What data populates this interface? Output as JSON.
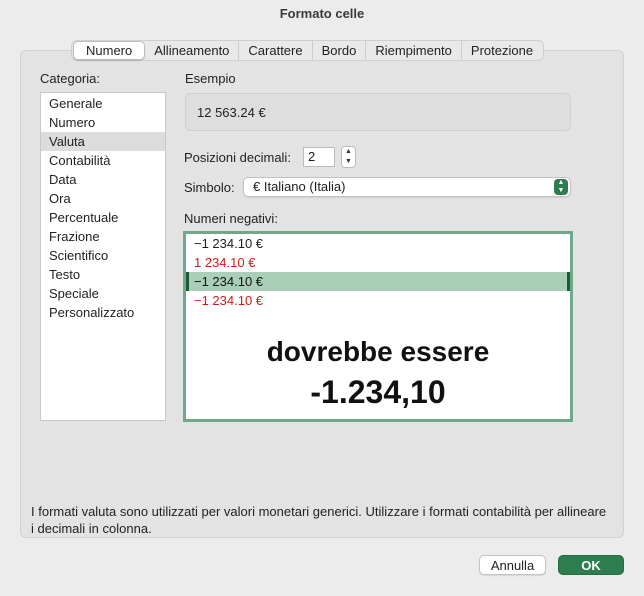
{
  "window": {
    "title": "Formato celle"
  },
  "tabs": [
    "Numero",
    "Allineamento",
    "Carattere",
    "Bordo",
    "Riempimento",
    "Protezione"
  ],
  "active_tab": "Numero",
  "category": {
    "label": "Categoria:",
    "items": [
      "Generale",
      "Numero",
      "Valuta",
      "Contabilità",
      "Data",
      "Ora",
      "Percentuale",
      "Frazione",
      "Scientifico",
      "Testo",
      "Speciale",
      "Personalizzato"
    ],
    "selected": "Valuta"
  },
  "example": {
    "label": "Esempio",
    "value": "12 563.24 €"
  },
  "decimals": {
    "label": "Posizioni decimali:",
    "value": "2"
  },
  "symbol": {
    "label": "Simbolo:",
    "value": "€ Italiano (Italia)"
  },
  "negatives": {
    "label": "Numeri negativi:",
    "items": [
      {
        "text": "−1 234.10 €",
        "color": "#1d1d1d"
      },
      {
        "text": "1 234.10 €",
        "color": "#d11a1a"
      },
      {
        "text": "−1 234.10 €",
        "color": "#111111"
      },
      {
        "text": "−1 234.10 €",
        "color": "#d11a1a"
      }
    ],
    "selected_index": 2
  },
  "annotation": {
    "line1": "dovrebbe essere",
    "line2": "-1.234,10"
  },
  "description": "I formati valuta sono utilizzati per valori monetari generici. Utilizzare i formati contabilità per allineare i decimali in colonna.",
  "buttons": {
    "cancel": "Annulla",
    "ok": "OK"
  },
  "colors": {
    "accent": "#2e7d4f",
    "selection": "#a9cfb8",
    "negative_red": "#d11a1a"
  }
}
